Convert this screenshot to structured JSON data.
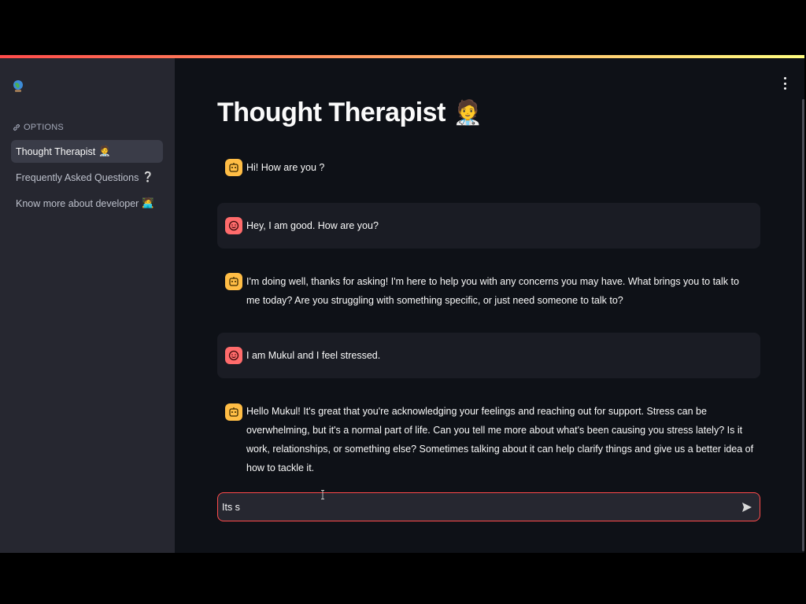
{
  "app": {
    "title": "Thought Therapist",
    "title_emoji": "🧑‍⚕️",
    "accent_color": "#ff4b4b"
  },
  "sidebar": {
    "heading": "OPTIONS",
    "heading_icon": "link-icon",
    "items": [
      {
        "label": "Thought Therapist",
        "emoji": "🧑‍⚕️",
        "active": true
      },
      {
        "label": "Frequently Asked Questions",
        "emoji": "❔",
        "active": false
      },
      {
        "label": "Know more about developer",
        "emoji": "🧑‍💻",
        "active": false
      }
    ]
  },
  "chat": {
    "messages": [
      {
        "role": "assistant",
        "avatar_icon": "bot-icon",
        "text": "Hi! How are you ?"
      },
      {
        "role": "user",
        "avatar_icon": "user-face-icon",
        "text": "Hey, I am good. How are you?"
      },
      {
        "role": "assistant",
        "avatar_icon": "bot-icon",
        "text": "I'm doing well, thanks for asking! I'm here to help you with any concerns you may have. What brings you to talk to me today? Are you struggling with something specific, or just need someone to talk to?"
      },
      {
        "role": "user",
        "avatar_icon": "user-face-icon",
        "text": "I am Mukul and I feel stressed."
      },
      {
        "role": "assistant",
        "avatar_icon": "bot-icon",
        "text": "Hello Mukul! It's great that you're acknowledging your feelings and reaching out for support. Stress can be overwhelming, but it's a normal part of life. Can you tell me more about what's been causing you stress lately? Is it work, relationships, or something else? Sometimes talking about it can help clarify things and give us a better idea of how to tackle it."
      }
    ],
    "input": {
      "value": "Its s",
      "send_icon": "send-icon"
    }
  }
}
